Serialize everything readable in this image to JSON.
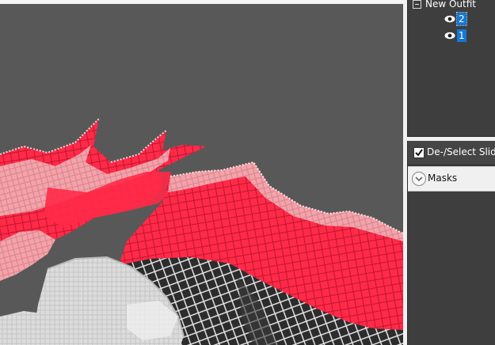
{
  "outfit_tree": {
    "root": {
      "label": "New Outfit",
      "expanded": true
    },
    "shapes": [
      {
        "label": "2",
        "visible": true,
        "selected": true,
        "focused": true
      },
      {
        "label": "1",
        "visible": true,
        "selected": true,
        "focused": false
      }
    ]
  },
  "slider_panel": {
    "toggle_label": "De-/Select Sliders",
    "toggle_checked": true
  },
  "masks_section": {
    "label": "Masks",
    "expanded": false
  },
  "colors": {
    "viewport_bg": "#585858",
    "panel_bg": "#3e3e3e",
    "selection": "#1577d4",
    "mesh_red": "#ff2a48",
    "mesh_pink": "#f4a3ab",
    "mesh_white": "#e6e6e6"
  }
}
